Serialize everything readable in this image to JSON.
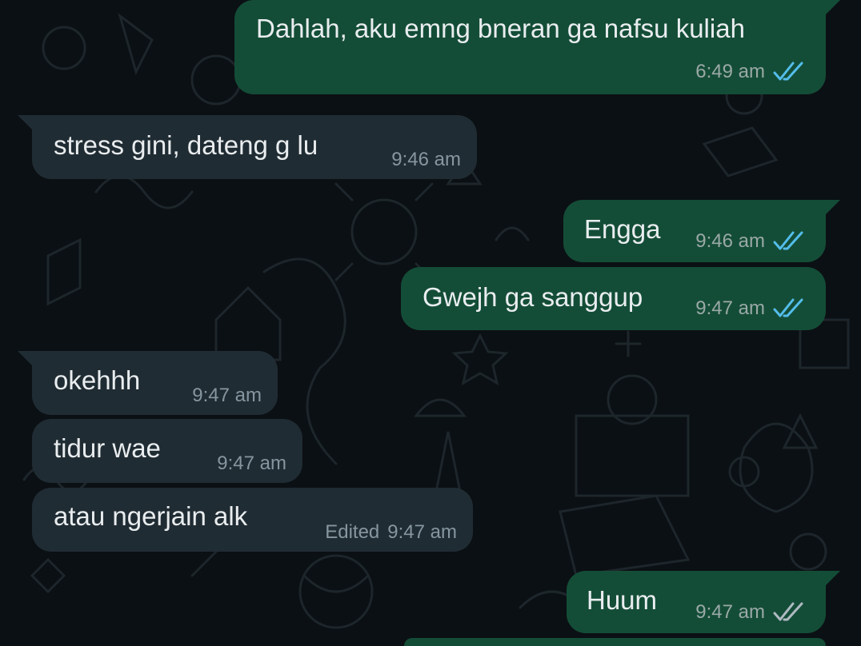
{
  "colors": {
    "background": "#0b1014",
    "outgoing_bubble": "#144d37",
    "incoming_bubble": "#202c33",
    "read_tick": "#53bdeb",
    "delivered_tick": "#aebac1",
    "text": "#e9edef",
    "meta_text": "#8696a0"
  },
  "messages": [
    {
      "direction": "outgoing",
      "text": "Dahlah, aku emng bneran ga nafsu kuliah",
      "time": "6:49 am",
      "status": "read",
      "status_icon": "double-check-icon"
    },
    {
      "direction": "incoming",
      "text": "stress gini, dateng g lu",
      "time": "9:46 am"
    },
    {
      "direction": "outgoing",
      "text": "Engga",
      "time": "9:46 am",
      "status": "read",
      "status_icon": "double-check-icon"
    },
    {
      "direction": "outgoing",
      "text": "Gwejh ga sanggup",
      "time": "9:47 am",
      "status": "read",
      "status_icon": "double-check-icon"
    },
    {
      "direction": "incoming",
      "text": "okehhh",
      "time": "9:47 am"
    },
    {
      "direction": "incoming",
      "text": "tidur wae",
      "time": "9:47 am"
    },
    {
      "direction": "incoming",
      "text": "atau ngerjain alk",
      "time": "9:47 am",
      "edited_label": "Edited"
    },
    {
      "direction": "outgoing",
      "text": "Huum",
      "time": "9:47 am",
      "status": "delivered",
      "status_icon": "double-check-icon"
    }
  ]
}
